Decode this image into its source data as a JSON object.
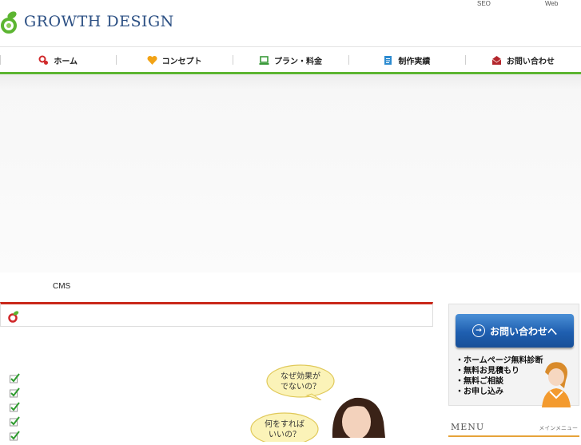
{
  "header": {
    "brand": "GROWTH DESIGN",
    "top_links": [
      "SEO",
      "Web"
    ]
  },
  "nav": {
    "items": [
      {
        "label": "ホーム",
        "icon": "home-pin-icon"
      },
      {
        "label": "コンセプト",
        "icon": "heart-icon"
      },
      {
        "label": "プラン・料金",
        "icon": "laptop-icon"
      },
      {
        "label": "制作実績",
        "icon": "document-icon"
      },
      {
        "label": "お問い合わせ",
        "icon": "envelope-icon"
      }
    ]
  },
  "hero": {
    "caption": "CMS"
  },
  "illustration": {
    "bubble1": [
      "なぜ効果が",
      "でないの？"
    ],
    "bubble2": [
      "何をすれば",
      "いいの？"
    ]
  },
  "sidebar": {
    "contact_button": "お問い合わせへ",
    "contact_items": [
      "ホームページ無料診断",
      "無料お見積もり",
      "無料ご相談",
      "お申し込み"
    ],
    "menu_title": "MENU",
    "menu_subtitle": "メインメニュー"
  },
  "colors": {
    "brand_blue": "#2b4f83",
    "brand_green": "#5cb531",
    "heading_red": "#c9281a",
    "button_blue": "#1f5fb0",
    "menu_orange": "#e6a33a"
  }
}
